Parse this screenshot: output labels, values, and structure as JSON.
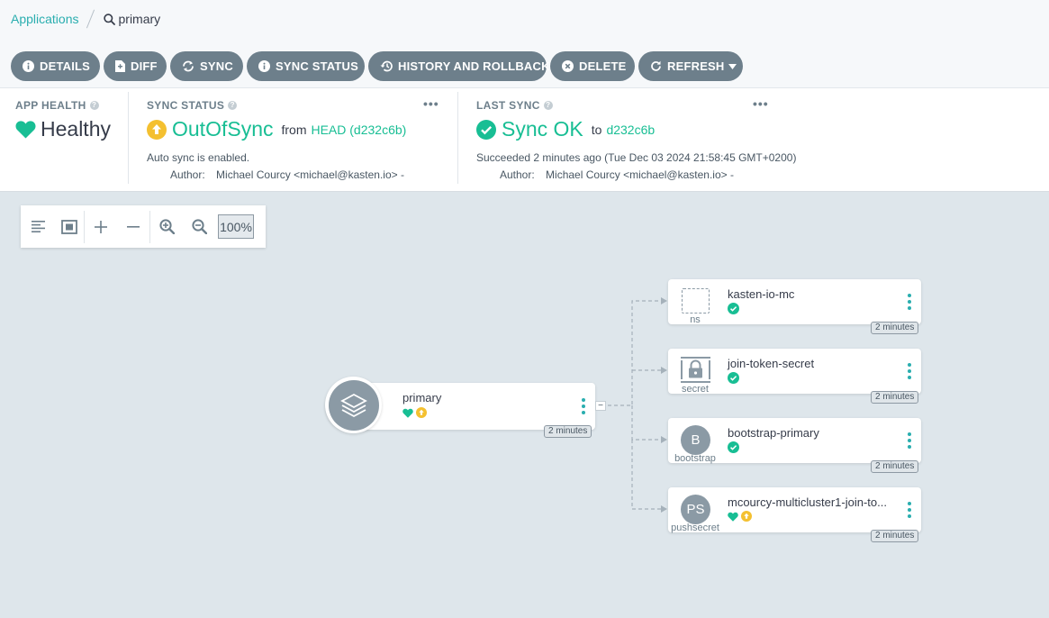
{
  "breadcrumb": {
    "root": "Applications",
    "current": "primary"
  },
  "toolbar": {
    "details": "DETAILS",
    "diff": "DIFF",
    "sync": "SYNC",
    "sync_status": "SYNC STATUS",
    "history": "HISTORY AND ROLLBACK",
    "delete": "DELETE",
    "refresh": "REFRESH"
  },
  "app_health": {
    "title": "APP HEALTH",
    "value": "Healthy"
  },
  "sync_status": {
    "title": "SYNC STATUS",
    "value": "OutOfSync",
    "from_label": "from",
    "revision": "HEAD (d232c6b)",
    "auto_sync": "Auto sync is enabled.",
    "author_label": "Author:",
    "author": "Michael Courcy <michael@kasten.io> -",
    "more": "•••"
  },
  "last_sync": {
    "title": "LAST SYNC",
    "value": "Sync OK",
    "to_label": "to",
    "revision": "d232c6b",
    "detail": "Succeeded 2 minutes ago (Tue Dec 03 2024 21:58:45 GMT+0200)",
    "author_label": "Author:",
    "author": "Michael Courcy <michael@kasten.io> -",
    "more": "•••"
  },
  "zoom": {
    "level": "100%"
  },
  "colors": {
    "teal": "#18be94",
    "warning": "#f4c030",
    "button": "#6d7f8b",
    "link": "#2aaeaf"
  },
  "graph": {
    "root": {
      "name": "primary",
      "age": "2 minutes",
      "collapse": "−",
      "icon": "layers-icon",
      "health": "healthy",
      "sync": "out-of-sync"
    },
    "children": [
      {
        "name": "kasten-io-mc",
        "kind": "ns",
        "age": "2 minutes",
        "icon": "namespace-dashed-box-icon",
        "sync": "synced"
      },
      {
        "name": "join-token-secret",
        "kind": "secret",
        "age": "2 minutes",
        "icon": "secret-lock-icon",
        "sync": "synced"
      },
      {
        "name": "bootstrap-primary",
        "kind": "bootstrap",
        "age": "2 minutes",
        "icon_text": "B",
        "sync": "synced"
      },
      {
        "name": "mcourcy-multicluster1-join-to...",
        "kind": "pushsecret",
        "age": "2 minutes",
        "icon_text": "PS",
        "health": "healthy",
        "sync": "out-of-sync"
      }
    ]
  }
}
